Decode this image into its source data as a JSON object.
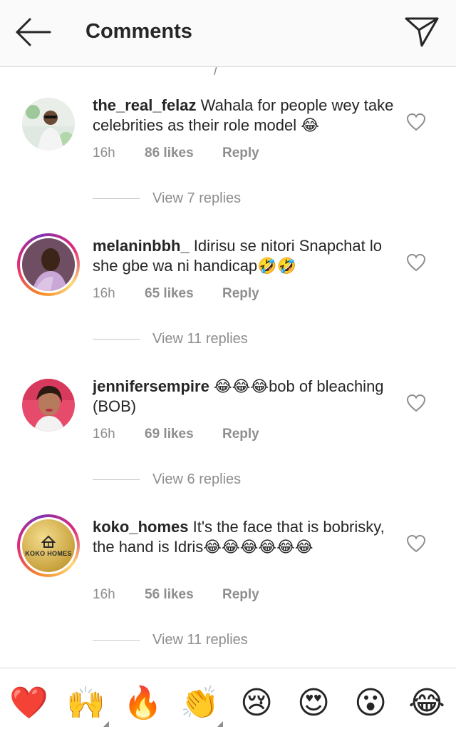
{
  "header": {
    "title": "Comments"
  },
  "scroll_fragment": "/",
  "comments": [
    {
      "username": "the_real_felaz",
      "text": " Wahala for people wey take celebrities as their role model 😂",
      "time": "16h",
      "likes": "86 likes",
      "reply": "Reply",
      "view_replies": "View 7 replies",
      "story_ring": false
    },
    {
      "username": "melaninbbh_",
      "text": " Idirisu se nitori Snapchat lo she gbe wa ni handicap🤣🤣",
      "time": "16h",
      "likes": "65 likes",
      "reply": "Reply",
      "view_replies": "View 11 replies",
      "story_ring": true
    },
    {
      "username": "jennifersempire",
      "text": " 😂😂😂bob of bleaching (BOB)",
      "time": "16h",
      "likes": "69 likes",
      "reply": "Reply",
      "view_replies": "View 6 replies",
      "story_ring": false
    },
    {
      "username": "koko_homes",
      "text": " It's the face that is bobrisky, the hand is Idris😂😂😂😂😂😂",
      "time": "16h",
      "likes": "56 likes",
      "reply": "Reply",
      "view_replies": "View 11 replies",
      "story_ring": true,
      "avatar_logo_text": "KOKO HOMES"
    }
  ],
  "emoji_bar": [
    "❤️",
    "🙌",
    "🔥",
    "👏",
    "😢",
    "😍",
    "😮",
    "😂"
  ],
  "colors": {
    "meta_gray": "#8e8e8e",
    "text": "#262626",
    "heart_red": "#e0245e"
  }
}
